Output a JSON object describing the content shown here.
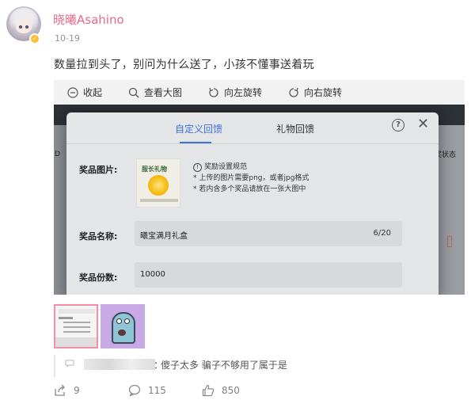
{
  "post": {
    "username": "晓曦Asahino",
    "date": "10-19",
    "text": "数量拉到头了，别问为什么送了，小孩不懂事送着玩"
  },
  "toolbar": {
    "collapse": "收起",
    "view_large": "查看大图",
    "rotate_left": "向左旋转",
    "rotate_right": "向右旋转"
  },
  "photo": {
    "bg_left_fragment": "D",
    "bg_right_fragment": "奖状态",
    "dialog": {
      "tab_custom": "自定义回馈",
      "tab_gift": "礼物回馈",
      "help": "?",
      "close": "✕",
      "prize_image_label": "奖品图片:",
      "prize_image_caption": "服长礼物",
      "note_title": "奖励设置规范",
      "note_1": "* 上传的图片需要png，或者jpg格式",
      "note_2": "* 若内含多个奖品请放在一张大图中",
      "prize_name_label": "奖品名称:",
      "prize_name_value": "曦宝满月礼盒",
      "prize_name_count": "6/20",
      "prize_qty_label": "奖品份数:",
      "prize_qty_value": "10000"
    }
  },
  "comment": {
    "colon": "：",
    "text": "傻子太多 骗子不够用了属于是"
  },
  "actions": {
    "share_count": "9",
    "comment_count": "115",
    "like_count": "850"
  },
  "colors": {
    "username": "#e86b8a",
    "tab_active": "#3e71d6",
    "thumb_selected_border": "#f38ea6"
  }
}
